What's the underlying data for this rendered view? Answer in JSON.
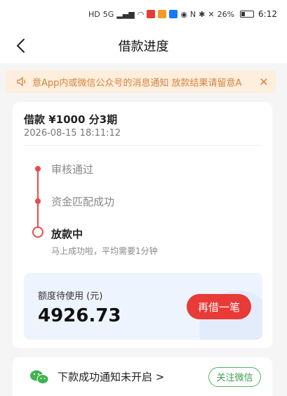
{
  "status_bar": {
    "network": "5G",
    "battery": "26%",
    "time": "6:12"
  },
  "header": {
    "title": "借款进度"
  },
  "notice": {
    "text": "意App内或微信公众号的消息通知 放款结果请留意A"
  },
  "loan": {
    "title": "借款 ¥1000  分3期",
    "time": "2026-08-15 18:11:12"
  },
  "timeline": {
    "steps": [
      "审核通过",
      "资金匹配成功"
    ],
    "current": "放款中",
    "current_sub": "马上成功啦，平均需要1分钟"
  },
  "quota": {
    "label": "额度待使用 (元)",
    "amount": "4926.73",
    "button": "再借一笔"
  },
  "wechat": {
    "text": "下款成功通知未开启 >",
    "button": "关注微信"
  },
  "colors": {
    "accent_red": "#e83a36",
    "notice_bg": "#fdeedd",
    "notice_text": "#d8833c",
    "wechat_green": "#3e9e4f"
  }
}
